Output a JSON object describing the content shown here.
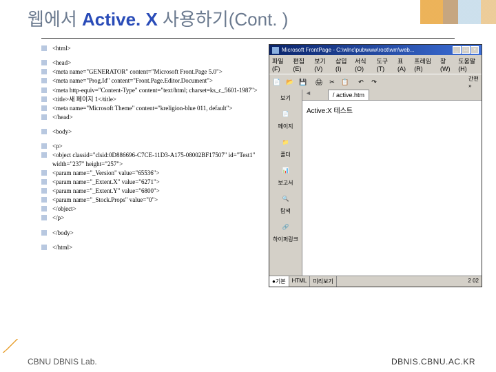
{
  "header": {
    "t1": "웹에서 ",
    "t2": "Active. X ",
    "t3": "사용하기(Cont. )"
  },
  "code": [
    {
      "t": "<html>",
      "s": 1
    },
    {
      "t": "<head>"
    },
    {
      "t": "<meta name=\"GENERATOR\" content=\"Microsoft Front.Page 5.0\">"
    },
    {
      "t": "<meta name=\"Prog.Id\" content=\"Front.Page.Editor.Document\">"
    },
    {
      "t": "<meta http-equiv=\"Content-Type\" content=\"text/html; charset=ks_c_5601-1987\">"
    },
    {
      "t": "<title>새 페이지 1</title>"
    },
    {
      "t": "<meta name=\"Microsoft Theme\" content=\"kreligion-blue 011, default\">"
    },
    {
      "t": "</head>",
      "s": 1
    },
    {
      "t": "<body>",
      "s": 1
    },
    {
      "t": "<p>"
    },
    {
      "t": "<object classid=\"clsid:0D886696-C7CE-11D3-A175-08002BF17507\" id=\"Test1\" width=\"237\" height=\"257\">"
    },
    {
      "t": "  <param name=\"_Version\" value=\"65536\">"
    },
    {
      "t": "  <param name=\"_Extent.X\" value=\"6271\">"
    },
    {
      "t": "  <param name=\"_Extent.Y\" value=\"6800\">"
    },
    {
      "t": "  <param name=\"_Stock.Props\" value=\"0\">"
    },
    {
      "t": "</object>"
    },
    {
      "t": "</p>",
      "s": 1
    },
    {
      "t": "</body>",
      "s": 1
    },
    {
      "t": "</html>"
    }
  ],
  "app": {
    "title": "Microsoft FrontPage - C:\\wlnc\\pubwww\\root\\wm\\web...",
    "menu": [
      "파일(F)",
      "편집(E)",
      "보기(V)",
      "삽입(I)",
      "서식(O)",
      "도구(T)",
      "표(A)",
      "프레임(R)",
      "창(W)",
      "도움말(H)"
    ],
    "side": [
      "보기",
      "페이지",
      "폴더",
      "보고서",
      "탐색",
      "하이퍼링크"
    ],
    "tab": "active.htm",
    "canvas": "Active:X 테스트",
    "status": [
      "●기본",
      "HTML",
      "미리보기"
    ],
    "sright": "2 02"
  },
  "footer": {
    "l": "CBNU DBNIS Lab.",
    "r": "DBNIS.CBNU.AC.KR"
  }
}
